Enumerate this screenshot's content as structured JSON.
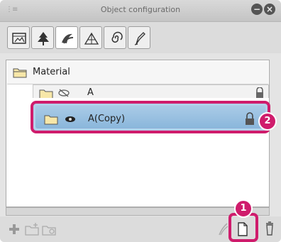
{
  "window": {
    "title": "Object configuration"
  },
  "toolbar": {
    "tabs": [
      {
        "icon": "canvas-frame-icon"
      },
      {
        "icon": "tree-icon"
      },
      {
        "icon": "brush-stroke-icon"
      },
      {
        "icon": "perspective-icon"
      },
      {
        "icon": "spiral-icon"
      },
      {
        "icon": "pen-tip-icon"
      }
    ]
  },
  "tree": {
    "root": {
      "label": "Material",
      "icon": "folder-icon"
    },
    "items": [
      {
        "label": "A",
        "visible": false,
        "locked": true
      },
      {
        "label": "A(Copy)",
        "visible": true,
        "locked": true,
        "selected": true
      }
    ]
  },
  "callouts": {
    "one": "1",
    "two": "2"
  },
  "colors": {
    "highlight": "#cf1c6c",
    "selection": "#9dc3e4"
  }
}
